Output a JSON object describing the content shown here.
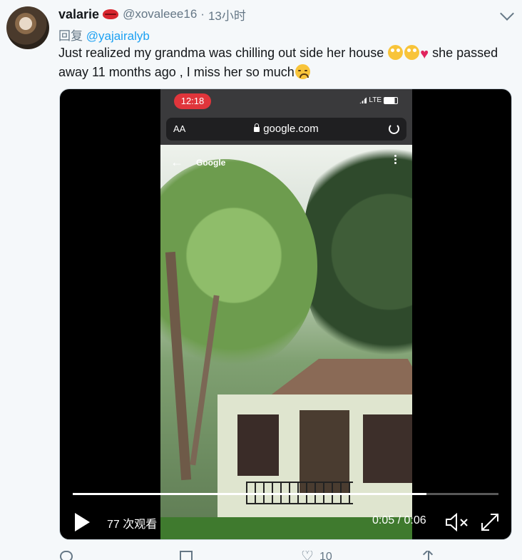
{
  "tweet": {
    "display_name": "valarie",
    "handle": "@xovaleee16",
    "separator": "·",
    "time": "13小时",
    "reply_prefix": "回复",
    "reply_to": "@yajairalyb",
    "text_part1": "Just realized my grandma was chilling out side her house ",
    "text_part2": " she passed away 11 months ago , I miss her so much",
    "emojis": [
      "rolling-eyes-emoji",
      "rolling-eyes-emoji",
      "red-heart-emoji",
      "disappointed-face-emoji"
    ]
  },
  "video": {
    "phone_clock": "12:18",
    "carrier": "LTE",
    "aa_label": "AA",
    "url": "google.com",
    "page_title": "Google",
    "views": "77 次观看",
    "time_display": "0:05 / 0:06",
    "progress": 0.83
  },
  "actions": {
    "like_count": "10"
  },
  "colors": {
    "link": "#1da1f2",
    "secondary_text": "#657786",
    "primary_text": "#14171a",
    "clock_pill": "#e0353b"
  }
}
